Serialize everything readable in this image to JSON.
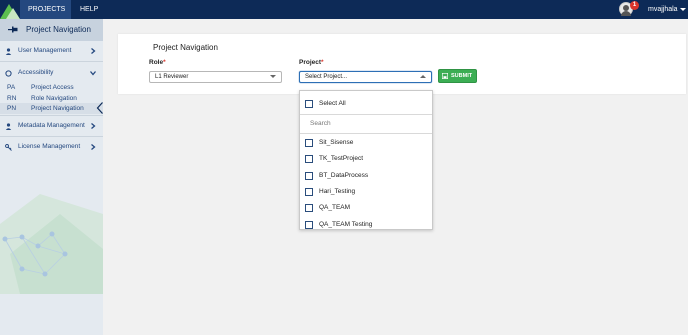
{
  "topbar": {
    "nav": [
      "PROJECTS",
      "HELP"
    ],
    "notification_count": "1",
    "username": "mvajjhala"
  },
  "sidebar": {
    "title": "Project Navigation",
    "sections": [
      {
        "label": "User Management"
      },
      {
        "label": "Accessibility"
      },
      {
        "label": "Metadata Management"
      },
      {
        "label": "License Management"
      }
    ],
    "sub_items": [
      {
        "abbr": "PA",
        "label": "Project Access"
      },
      {
        "abbr": "RN",
        "label": "Role Navigation"
      },
      {
        "abbr": "PN",
        "label": "Project Navigation"
      }
    ]
  },
  "main": {
    "title": "Project Navigation",
    "role_label": "Role",
    "project_label": "Project",
    "required_mark": "*",
    "role_value": "L1 Reviewer",
    "project_value": "Select Project...",
    "submit_label": "SUBMIT"
  },
  "dropdown": {
    "select_all": "Select All",
    "search_placeholder": "Search",
    "options": [
      "Sit_Sisense",
      "TK_TestProject",
      "BT_DataProcess",
      "Hari_Testing",
      "QA_TEAM",
      "QA_TEAM Testing"
    ]
  },
  "colors": {
    "topbar": "#0d2a57",
    "sidebar": "#e4eaf0",
    "submit": "#3cae54",
    "required": "#d9342b"
  }
}
